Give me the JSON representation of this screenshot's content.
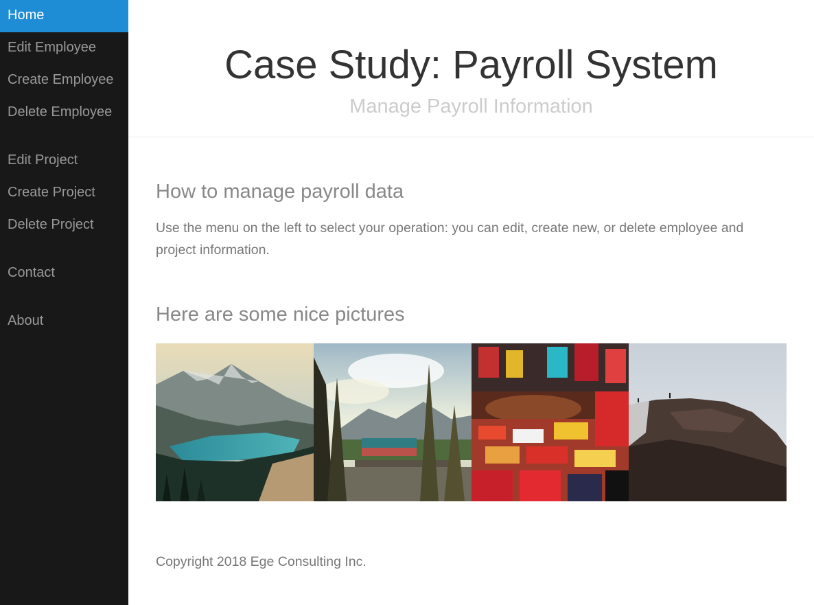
{
  "nav": {
    "items": [
      {
        "label": "Home",
        "active": true
      },
      {
        "label": "Edit Employee"
      },
      {
        "label": "Create Employee"
      },
      {
        "label": "Delete Employee"
      },
      {
        "label": "Edit Project"
      },
      {
        "label": "Create Project"
      },
      {
        "label": "Delete Project"
      },
      {
        "label": "Contact"
      },
      {
        "label": "About"
      }
    ]
  },
  "header": {
    "title": "Case Study: Payroll System",
    "subtitle": "Manage Payroll Information"
  },
  "content": {
    "section1_heading": "How to manage payroll data",
    "section1_text": "Use the menu on the left to select your operation: you can edit, create new, or delete employee and project information.",
    "section2_heading": "Here are some nice pictures"
  },
  "footer": {
    "copyright": "Copyright 2018 Ege Consulting Inc."
  },
  "colors": {
    "sidebar_bg": "#191818",
    "active_nav": "#1f8dd6"
  }
}
